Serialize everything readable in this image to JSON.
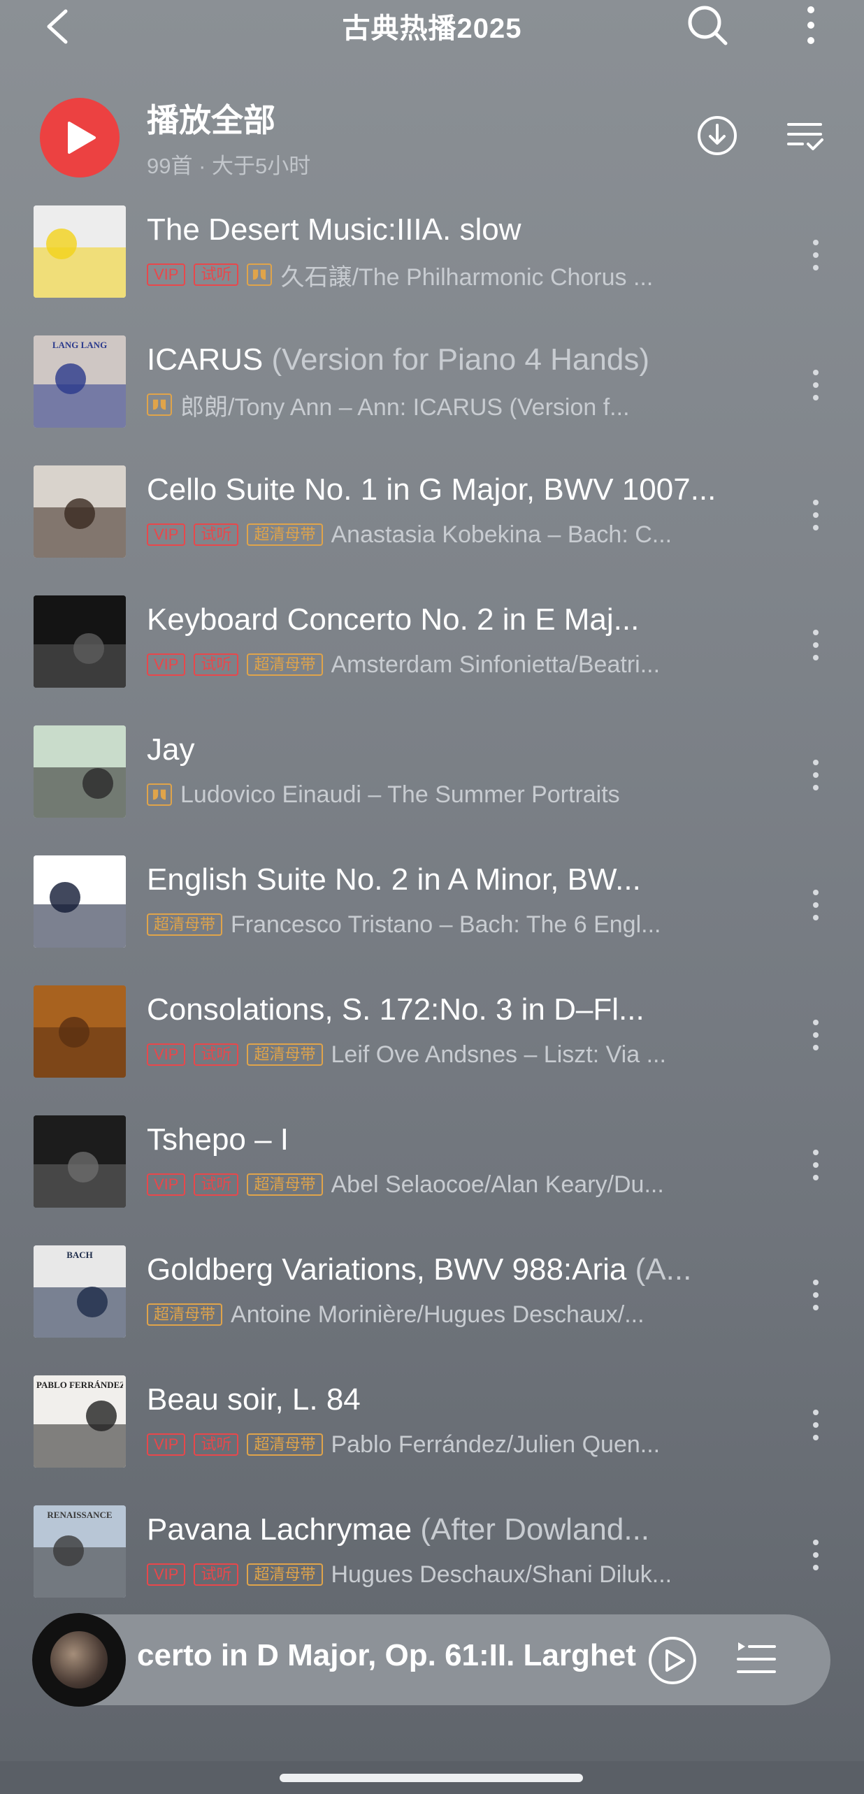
{
  "header": {
    "title": "古典热播2025"
  },
  "play_all": {
    "label": "播放全部",
    "meta": "99首 · 大于5小时"
  },
  "songs": [
    {
      "title": "The Desert Music:IIIA. slow",
      "subtitle": "",
      "tags": [
        "VIP",
        "试听",
        "dolby"
      ],
      "artist": "久石譲/The Philharmonic Chorus ..."
    },
    {
      "title": "ICARUS",
      "subtitle": " (Version for Piano 4 Hands)",
      "tags": [
        "dolby"
      ],
      "artist": "郎朗/Tony Ann – Ann: ICARUS (Version f..."
    },
    {
      "title": "Cello Suite No. 1 in G Major, BWV 1007...",
      "subtitle": "",
      "tags": [
        "VIP",
        "试听",
        "超清母带"
      ],
      "artist": "Anastasia Kobekina – Bach: C..."
    },
    {
      "title": "Keyboard Concerto No. 2 in E Maj...",
      "subtitle": "",
      "tags": [
        "VIP",
        "试听",
        "超清母带"
      ],
      "artist": "Amsterdam Sinfonietta/Beatri..."
    },
    {
      "title": "Jay",
      "subtitle": "",
      "tags": [
        "dolby"
      ],
      "artist": "Ludovico Einaudi – The Summer Portraits"
    },
    {
      "title": "English Suite No. 2 in A Minor, BW...",
      "subtitle": "",
      "tags": [
        "超清母带"
      ],
      "artist": "Francesco Tristano – Bach: The 6 Engl..."
    },
    {
      "title": "Consolations, S. 172:No. 3 in D–Fl...",
      "subtitle": "",
      "tags": [
        "VIP",
        "试听",
        "超清母带"
      ],
      "artist": "Leif Ove Andsnes – Liszt: Via ..."
    },
    {
      "title": "Tshepo – I",
      "subtitle": "",
      "tags": [
        "VIP",
        "试听",
        "超清母带"
      ],
      "artist": "Abel Selaocoe/Alan Keary/Du..."
    },
    {
      "title": "Goldberg Variations, BWV 988:Aria",
      "subtitle": " (A...",
      "tags": [
        "超清母带"
      ],
      "artist": "Antoine Morinière/Hugues Deschaux/..."
    },
    {
      "title": "Beau soir, L. 84",
      "subtitle": "",
      "tags": [
        "VIP",
        "试听",
        "超清母带"
      ],
      "artist": "Pablo Ferrández/Julien Quen..."
    },
    {
      "title": "Pavana Lachrymae",
      "subtitle": " (After Dowland...",
      "tags": [
        "VIP",
        "试听",
        "超清母带"
      ],
      "artist": "Hugues Deschaux/Shani Diluk..."
    }
  ],
  "covers": [
    {
      "name": "desert-music-cover",
      "bg": "#ededed",
      "accent": "#f2d21a",
      "label": ""
    },
    {
      "name": "lang-lang-cover",
      "bg": "#cfc7c4",
      "accent": "#2b3a8c",
      "label": "LANG LANG"
    },
    {
      "name": "kobekina-cover",
      "bg": "#d9d3cc",
      "accent": "#3a2a20",
      "label": ""
    },
    {
      "name": "beatrice-rana-cover",
      "bg": "#141414",
      "accent": "#5c5c5c",
      "label": ""
    },
    {
      "name": "summer-portraits-cover",
      "bg": "#c9dccb",
      "accent": "#2a2a2a",
      "label": ""
    },
    {
      "name": "tristano-cover",
      "bg": "#ffffff",
      "accent": "#111a35",
      "label": ""
    },
    {
      "name": "andsnes-cover",
      "bg": "#a8621f",
      "accent": "#5a2f12",
      "label": ""
    },
    {
      "name": "selaocoe-cover",
      "bg": "#1c1c1c",
      "accent": "#6c6c6c",
      "label": ""
    },
    {
      "name": "bach-duo-cover",
      "bg": "#e8e8e8",
      "accent": "#1e2c4a",
      "label": "BACH"
    },
    {
      "name": "ferrandez-cover",
      "bg": "#f1efec",
      "accent": "#222222",
      "label": "PABLO FERRÁNDEZ"
    },
    {
      "name": "renaissance-cover",
      "bg": "#b8c6d6",
      "accent": "#3a3a3a",
      "label": "RENAISSANCE"
    }
  ],
  "player": {
    "now_playing": "certo in D Major, Op. 61:II. Larghet"
  },
  "colors": {
    "accent_red": "#ec4141",
    "tag_red": "#e9474b",
    "tag_gold": "#e0a44a"
  }
}
